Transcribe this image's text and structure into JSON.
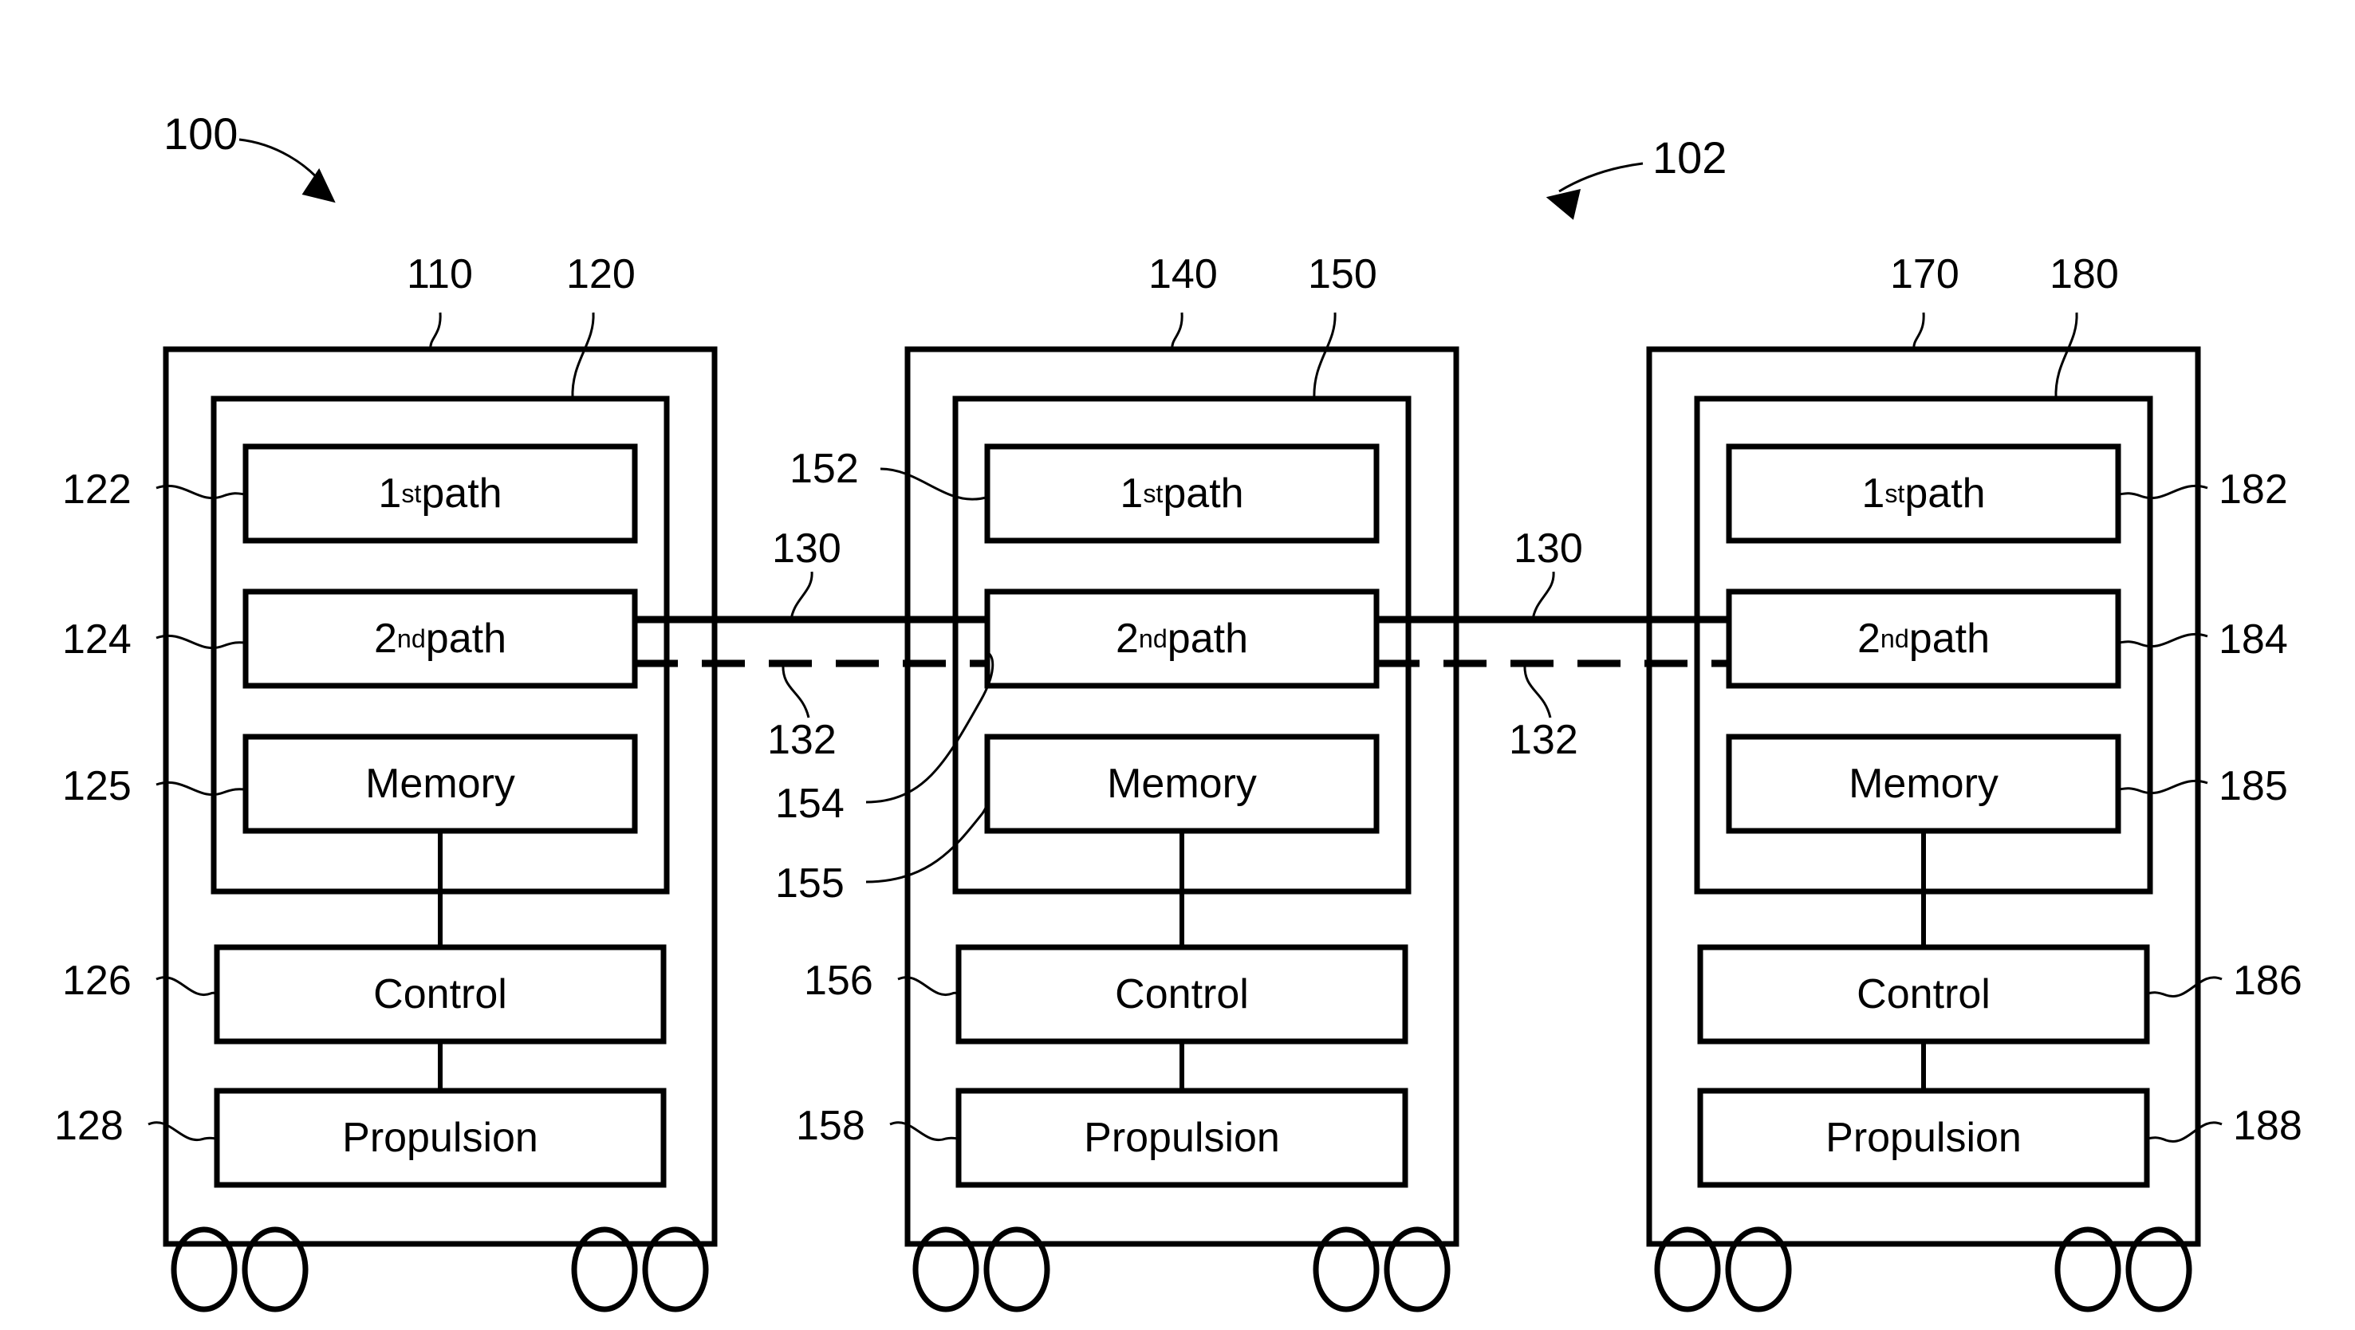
{
  "figure": {
    "type": "patent-block-diagram",
    "description": "Three vehicle units each containing a 1st path, 2nd path, Memory, Control and Propulsion block, interconnected by a solid communication line and a dashed communication line.",
    "system_labels": [
      {
        "id": "sys-100",
        "text": "100"
      },
      {
        "id": "sys-102",
        "text": "102"
      }
    ],
    "link_labels": [
      {
        "id": "link-130-left",
        "text": "130",
        "kind": "solid"
      },
      {
        "id": "link-132-left",
        "text": "132",
        "kind": "dashed"
      },
      {
        "id": "link-130-right",
        "text": "130",
        "kind": "solid"
      },
      {
        "id": "link-132-right",
        "text": "132",
        "kind": "dashed"
      }
    ],
    "units": [
      {
        "id": "unit-1",
        "outer_ref": "110",
        "inner_ref": "120",
        "blocks": [
          {
            "id": "unit1-first-path",
            "name": "first-path-block",
            "label_pre": "1",
            "label_sup": "st",
            "label_post": " path",
            "ref": "122",
            "ref_side": "left"
          },
          {
            "id": "unit1-second-path",
            "name": "second-path-block",
            "label_pre": "2",
            "label_sup": "nd",
            "label_post": " path",
            "ref": "124",
            "ref_side": "left"
          },
          {
            "id": "unit1-memory",
            "name": "memory-block",
            "label_pre": "Memory",
            "label_sup": "",
            "label_post": "",
            "ref": "125",
            "ref_side": "left"
          },
          {
            "id": "unit1-control",
            "name": "control-block",
            "label_pre": "Control",
            "label_sup": "",
            "label_post": "",
            "ref": "126",
            "ref_side": "left"
          },
          {
            "id": "unit1-propulsion",
            "name": "propulsion-block",
            "label_pre": "Propulsion",
            "label_sup": "",
            "label_post": "",
            "ref": "128",
            "ref_side": "left"
          }
        ],
        "wheel_count": 4
      },
      {
        "id": "unit-2",
        "outer_ref": "140",
        "inner_ref": "150",
        "blocks": [
          {
            "id": "unit2-first-path",
            "name": "first-path-block",
            "label_pre": "1",
            "label_sup": "st",
            "label_post": " path",
            "ref": "152",
            "ref_side": "left"
          },
          {
            "id": "unit2-second-path",
            "name": "second-path-block",
            "label_pre": "2",
            "label_sup": "nd",
            "label_post": " path",
            "ref": "154",
            "ref_side": "left"
          },
          {
            "id": "unit2-memory",
            "name": "memory-block",
            "label_pre": "Memory",
            "label_sup": "",
            "label_post": "",
            "ref": "155",
            "ref_side": "left"
          },
          {
            "id": "unit2-control",
            "name": "control-block",
            "label_pre": "Control",
            "label_sup": "",
            "label_post": "",
            "ref": "156",
            "ref_side": "left"
          },
          {
            "id": "unit2-propulsion",
            "name": "propulsion-block",
            "label_pre": "Propulsion",
            "label_sup": "",
            "label_post": "",
            "ref": "158",
            "ref_side": "left"
          }
        ],
        "wheel_count": 4
      },
      {
        "id": "unit-3",
        "outer_ref": "170",
        "inner_ref": "180",
        "blocks": [
          {
            "id": "unit3-first-path",
            "name": "first-path-block",
            "label_pre": "1",
            "label_sup": "st",
            "label_post": " path",
            "ref": "182",
            "ref_side": "right"
          },
          {
            "id": "unit3-second-path",
            "name": "second-path-block",
            "label_pre": "2",
            "label_sup": "nd",
            "label_post": " path",
            "ref": "184",
            "ref_side": "right"
          },
          {
            "id": "unit3-memory",
            "name": "memory-block",
            "label_pre": "Memory",
            "label_sup": "",
            "label_post": "",
            "ref": "185",
            "ref_side": "right"
          },
          {
            "id": "unit3-control",
            "name": "control-block",
            "label_pre": "Control",
            "label_sup": "",
            "label_post": "",
            "ref": "186",
            "ref_side": "right"
          },
          {
            "id": "unit3-propulsion",
            "name": "propulsion-block",
            "label_pre": "Propulsion",
            "label_sup": "",
            "label_post": "",
            "ref": "188",
            "ref_side": "right"
          }
        ],
        "wheel_count": 4
      }
    ]
  },
  "colors": {
    "ink": "#000000",
    "paper": "#ffffff"
  }
}
